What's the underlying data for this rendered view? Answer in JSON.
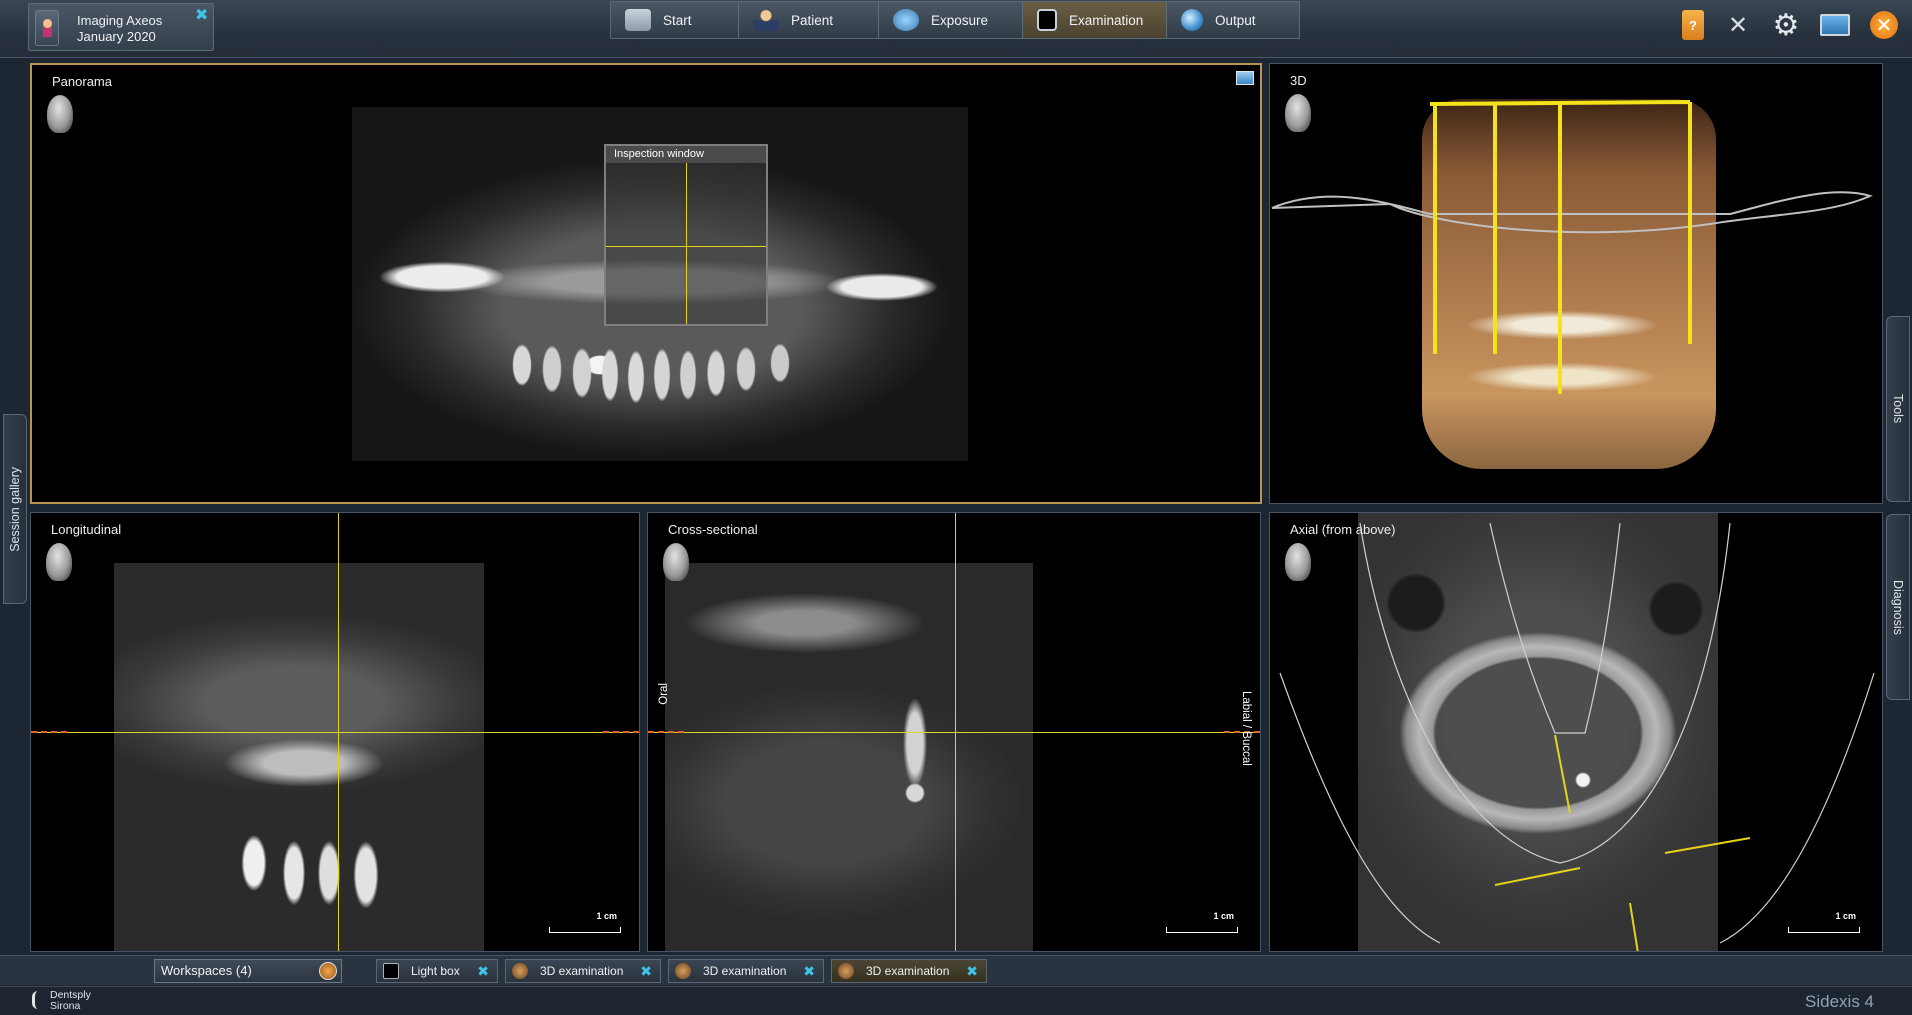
{
  "patient": {
    "name": "Imaging Axeos",
    "date": "January 2020",
    "close_icon": "close-x-icon"
  },
  "workflow": [
    {
      "label": "Start",
      "icon": "home-icon"
    },
    {
      "label": "Patient",
      "icon": "person-icon"
    },
    {
      "label": "Exposure",
      "icon": "xray-source-icon"
    },
    {
      "label": "Examination",
      "icon": "examination-icon",
      "active": true
    },
    {
      "label": "Output",
      "icon": "globe-icon"
    }
  ],
  "top_tools": [
    "help-book-icon",
    "tools-icon",
    "settings-gear-icon",
    "monitor-icon",
    "exit-icon"
  ],
  "panels": {
    "panorama": {
      "title": "Panorama",
      "inspection_window": "Inspection window",
      "selected": true
    },
    "three_d": {
      "title": "3D"
    },
    "longitudinal": {
      "title": "Longitudinal",
      "scale": "1 cm"
    },
    "cross_sectional": {
      "title": "Cross-sectional",
      "scale": "1 cm",
      "left_label": "Oral",
      "right_label": "Labial / Buccal"
    },
    "axial": {
      "title": "Axial (from above)",
      "scale": "1 cm"
    }
  },
  "side_tabs": {
    "left": "Session gallery",
    "right_top": "Tools",
    "right_bottom": "Diagnosis"
  },
  "workspaces": {
    "label": "Workspaces (4)",
    "tabs": [
      {
        "label": "Light box"
      },
      {
        "label": "3D examination"
      },
      {
        "label": "3D examination"
      },
      {
        "label": "3D examination",
        "active": true
      }
    ]
  },
  "brand": {
    "line1": "Dentsply",
    "line2": "Sirona"
  },
  "product": "Sidexis 4",
  "colors": {
    "accent_selected": "#b89650",
    "crosshair": "#e6d21a",
    "orientation_marker": "#e0662a",
    "close_x": "#3fc4e6"
  }
}
